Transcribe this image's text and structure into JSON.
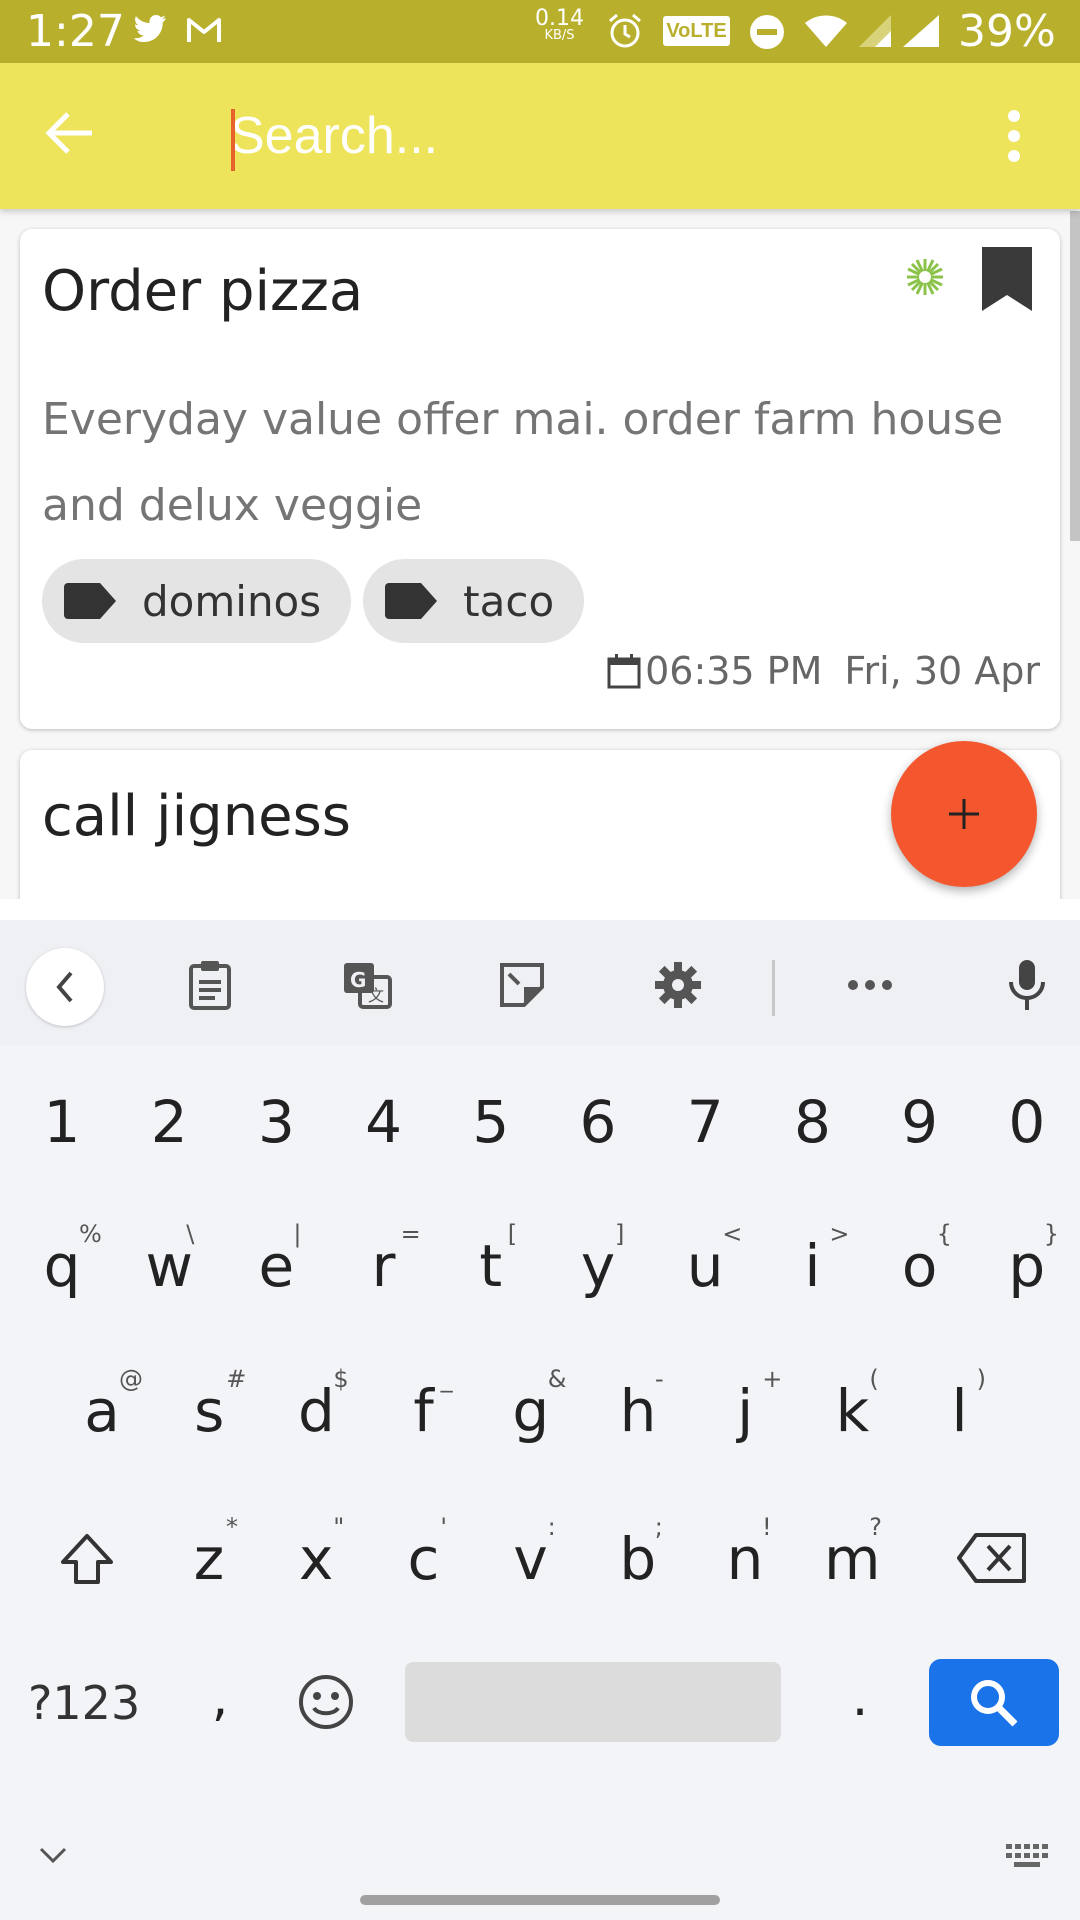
{
  "status_bar": {
    "time": "1:27",
    "net_speed": "0.14",
    "net_unit": "KB/S",
    "volte": "VoLTE",
    "battery": "39%"
  },
  "app_bar": {
    "search_placeholder": "Search..."
  },
  "notes": [
    {
      "title": "Order pizza",
      "body": "Everyday value offer mai. order farm house and delux veggie",
      "tags": [
        "dominos",
        "taco"
      ],
      "time": "06:35 PM",
      "date": "Fri, 30 Apr"
    },
    {
      "title": "call jigness"
    }
  ],
  "fab": {
    "label": "+"
  },
  "keyboard": {
    "numbers": [
      "1",
      "2",
      "3",
      "4",
      "5",
      "6",
      "7",
      "8",
      "9",
      "0"
    ],
    "row1": [
      "q",
      "w",
      "e",
      "r",
      "t",
      "y",
      "u",
      "i",
      "o",
      "p"
    ],
    "row1_hints": [
      "%",
      "\\",
      "|",
      "=",
      "[",
      "]",
      "<",
      ">",
      "{",
      "}"
    ],
    "row2": [
      "a",
      "s",
      "d",
      "f",
      "g",
      "h",
      "j",
      "k",
      "l"
    ],
    "row2_hints": [
      "@",
      "#",
      "$",
      "_",
      "&",
      "-",
      "+",
      "(",
      ")"
    ],
    "row3": [
      "z",
      "x",
      "c",
      "v",
      "b",
      "n",
      "m"
    ],
    "row3_hints": [
      "*",
      "\"",
      "'",
      ":",
      ";",
      "!",
      "?"
    ],
    "symbols_key": "?123",
    "comma": ",",
    "period": "."
  },
  "colors": {
    "status_bar": "#b8b02d",
    "app_bar": "#ede45c",
    "fab": "#f4562e",
    "search_key": "#1a73e8"
  }
}
